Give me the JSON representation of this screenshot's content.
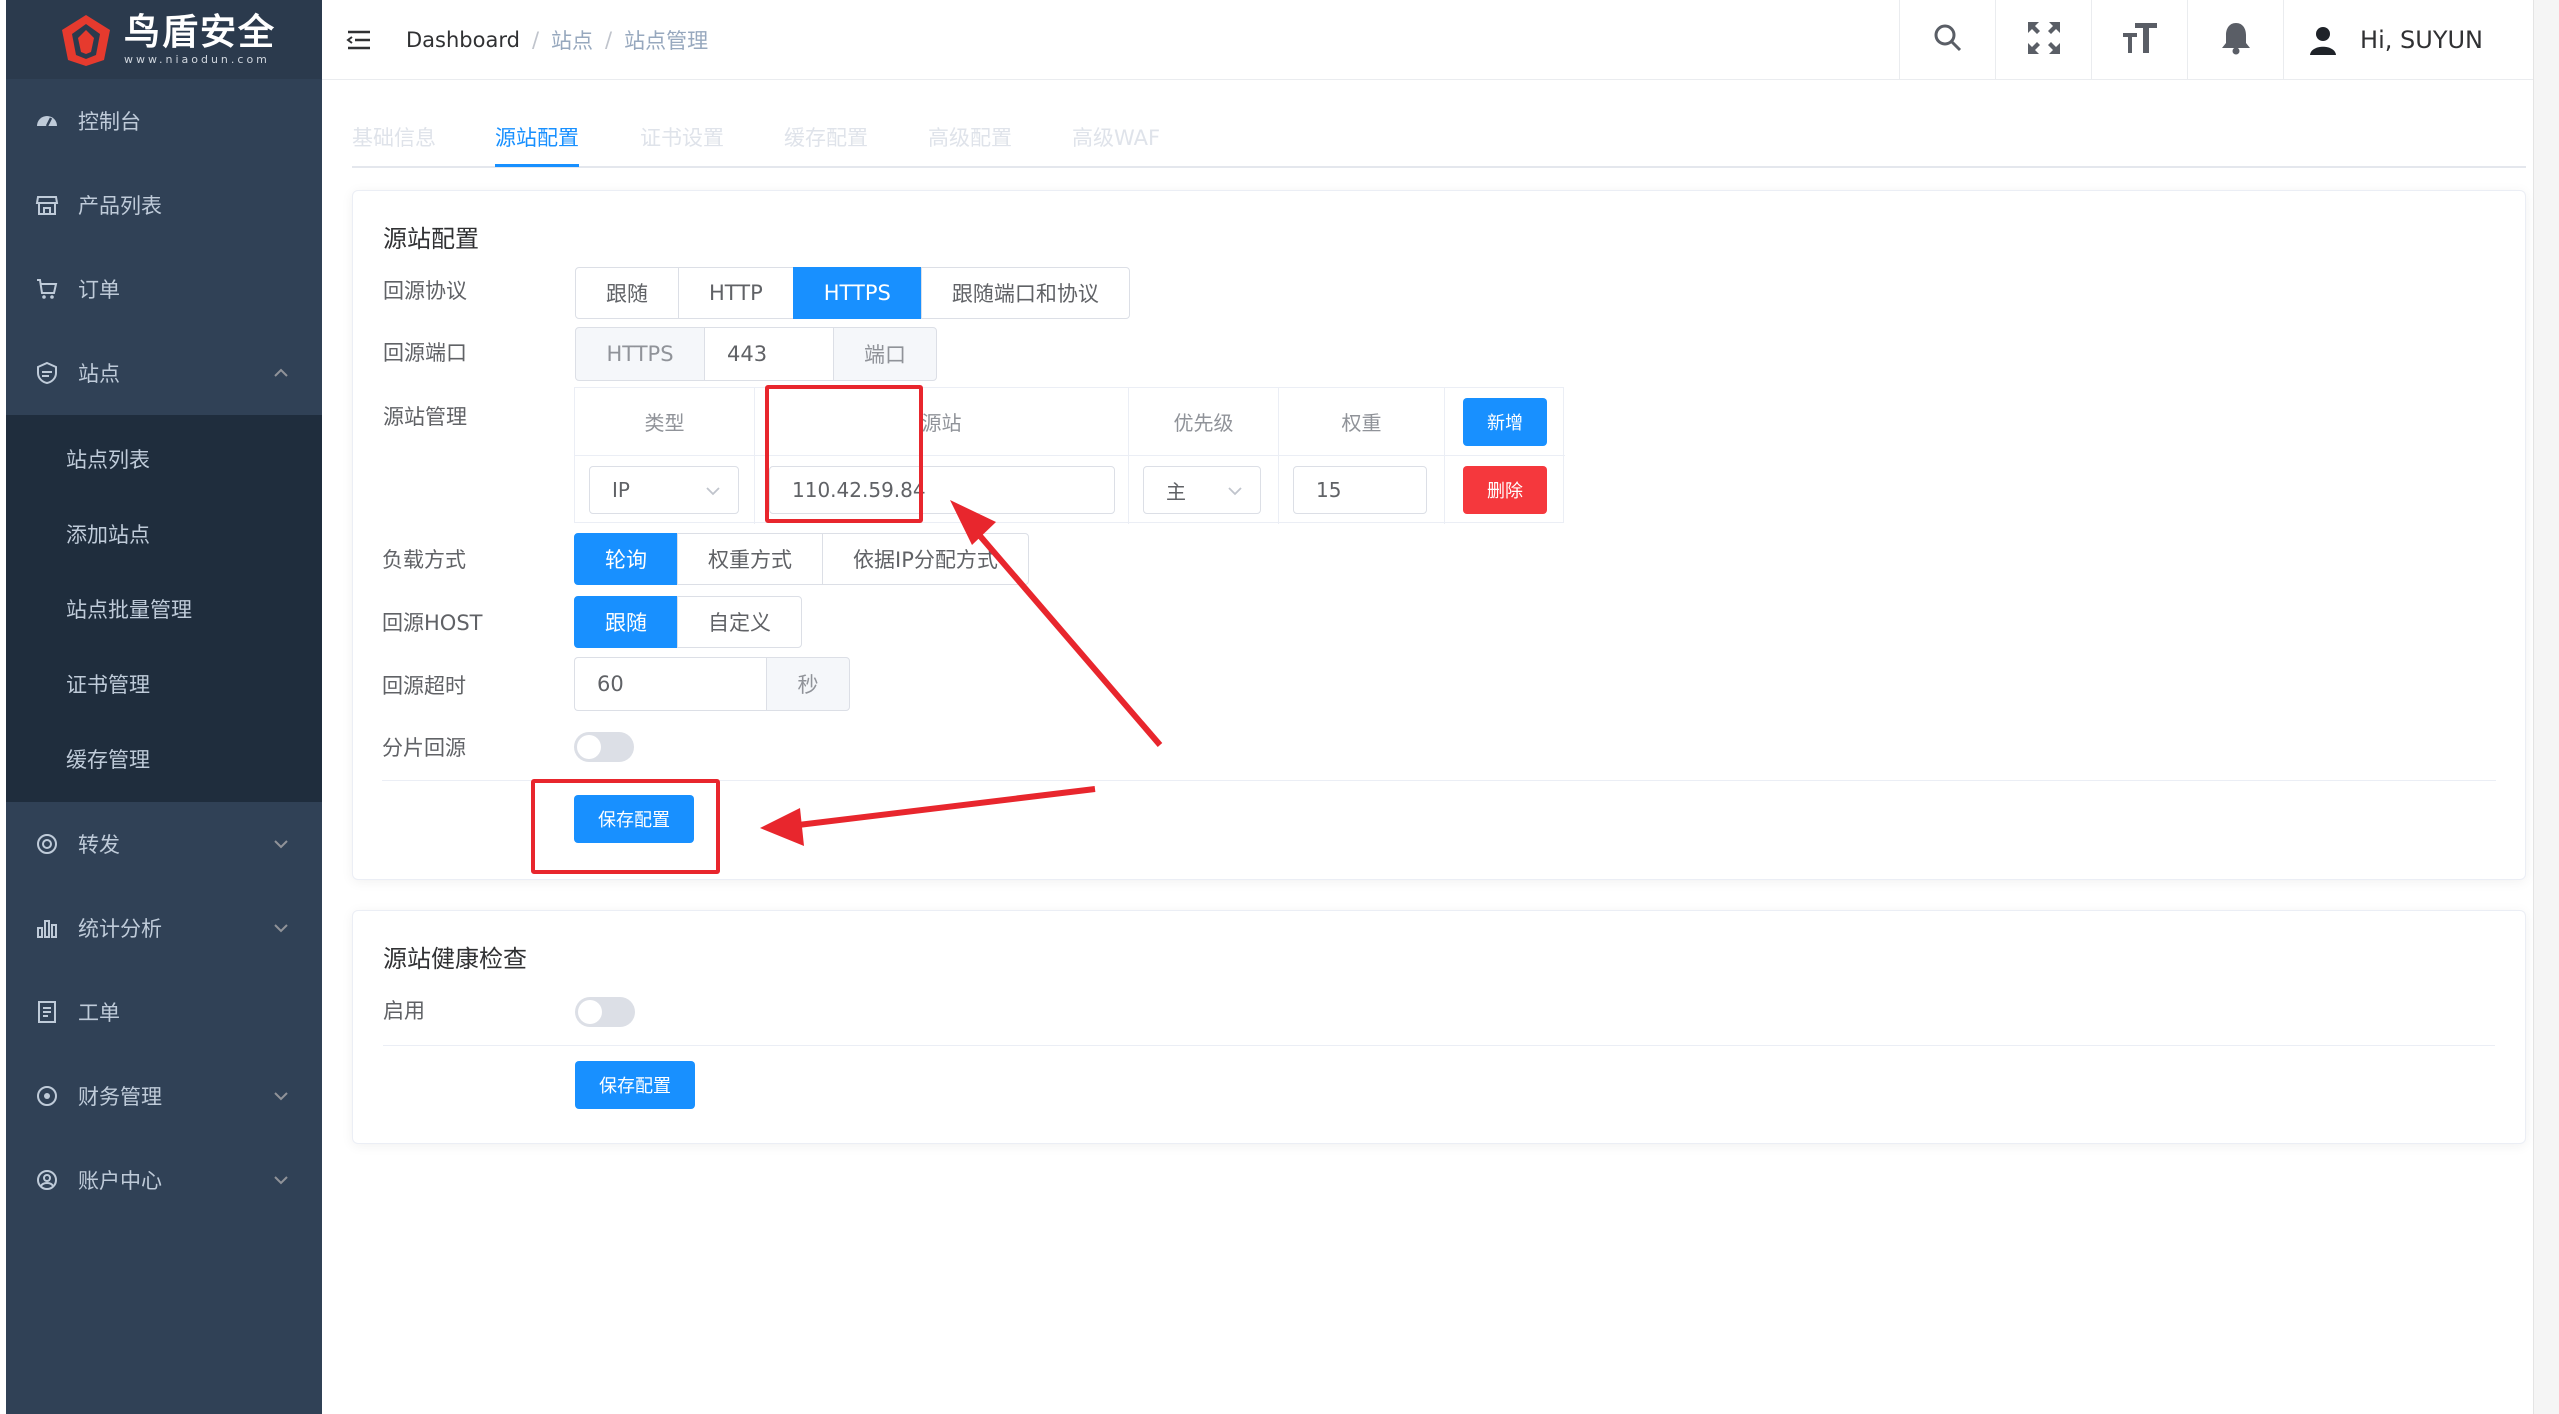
{
  "brand": {
    "name": "鸟盾安全",
    "domain": "www.niaodun.com"
  },
  "sidebar": {
    "items": [
      {
        "label": "控制台",
        "icon": "dashboard-icon"
      },
      {
        "label": "产品列表",
        "icon": "store-icon"
      },
      {
        "label": "订单",
        "icon": "cart-icon"
      },
      {
        "label": "站点",
        "icon": "site-icon",
        "expanded": true
      },
      {
        "label": "转发",
        "icon": "forward-icon"
      },
      {
        "label": "统计分析",
        "icon": "chart-icon"
      },
      {
        "label": "工单",
        "icon": "ticket-icon"
      },
      {
        "label": "财务管理",
        "icon": "finance-icon"
      },
      {
        "label": "账户中心",
        "icon": "account-icon"
      }
    ],
    "site_sub": [
      "站点列表",
      "添加站点",
      "站点批量管理",
      "证书管理",
      "缓存管理"
    ]
  },
  "header": {
    "breadcrumb": [
      "Dashboard",
      "站点",
      "站点管理"
    ],
    "separator": "/",
    "greeting": "Hi, SUYUN"
  },
  "tabs": [
    "基础信息",
    "源站配置",
    "证书设置",
    "缓存配置",
    "高级配置",
    "高级WAF"
  ],
  "active_tab": "源站配置",
  "origin": {
    "title": "源站配置",
    "protocol": {
      "label": "回源协议",
      "options": [
        "跟随",
        "HTTP",
        "HTTPS",
        "跟随端口和协议"
      ],
      "selected": "HTTPS"
    },
    "port": {
      "label": "回源端口",
      "prefix": "HTTPS",
      "value": "443",
      "suffix": "端口"
    },
    "manage": {
      "label": "源站管理",
      "columns": [
        "类型",
        "源站",
        "优先级",
        "权重"
      ],
      "add_label": "新增",
      "row": {
        "type": "IP",
        "address": "110.42.59.84",
        "priority": "主",
        "weight": "15",
        "delete_label": "删除"
      }
    },
    "balance": {
      "label": "负载方式",
      "options": [
        "轮询",
        "权重方式",
        "依据IP分配方式"
      ],
      "selected": "轮询"
    },
    "host": {
      "label": "回源HOST",
      "options": [
        "跟随",
        "自定义"
      ],
      "selected": "跟随"
    },
    "timeout": {
      "label": "回源超时",
      "value": "60",
      "suffix": "秒"
    },
    "chunk": {
      "label": "分片回源",
      "enabled": false
    },
    "save_label": "保存配置"
  },
  "health": {
    "title": "源站健康检查",
    "enable_label": "启用",
    "enabled": false,
    "save_label": "保存配置"
  },
  "colors": {
    "primary": "#1890ff",
    "danger": "#f5383d",
    "sidebar": "#304156",
    "annotation": "#e8262d"
  }
}
